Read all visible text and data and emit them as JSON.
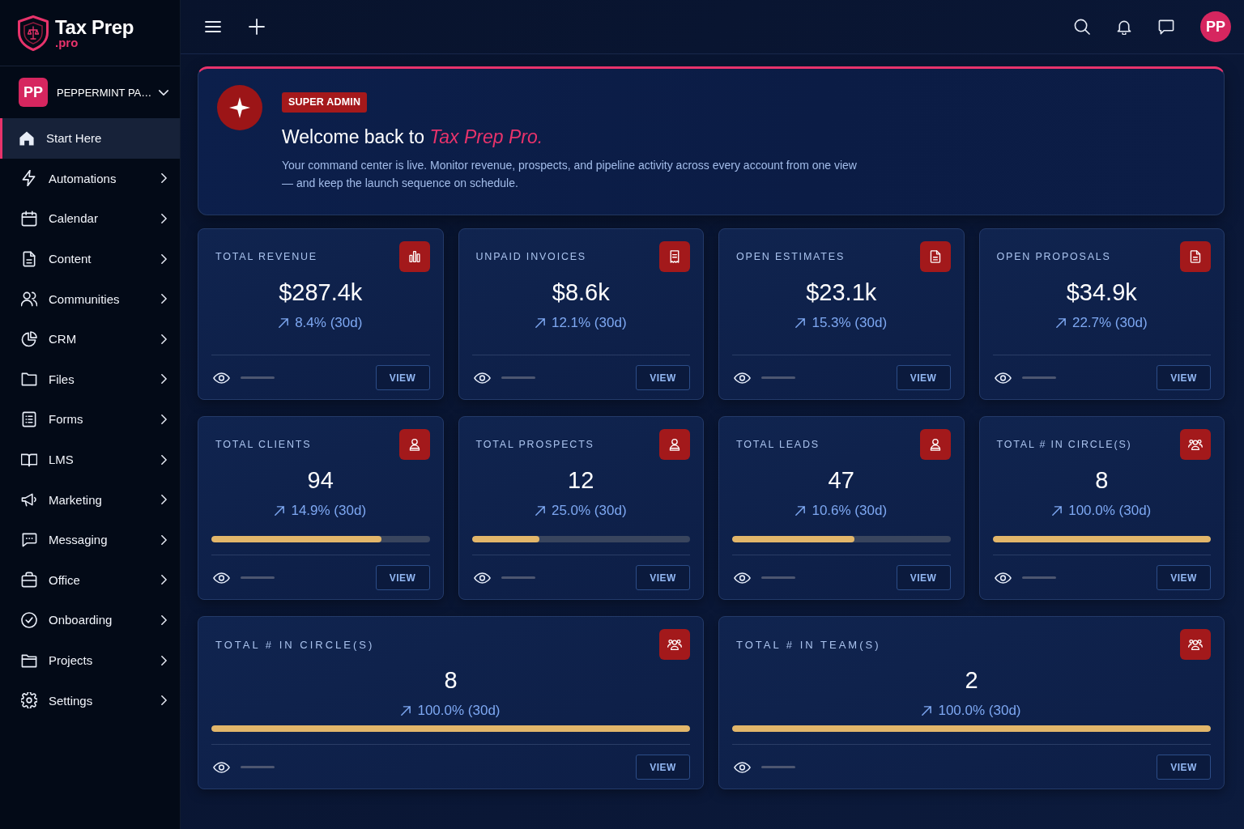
{
  "sidebar": {
    "logo": {
      "name": "Tax Prep",
      "suffix": ".pro"
    },
    "account": {
      "initials": "PP",
      "name": "PEPPERMINT PA…"
    },
    "items": [
      {
        "label": "Start Here",
        "selected": true,
        "expandable": false
      },
      {
        "label": "Automations",
        "selected": false,
        "expandable": true
      },
      {
        "label": "Calendar",
        "selected": false,
        "expandable": true
      },
      {
        "label": "Content",
        "selected": false,
        "expandable": true
      },
      {
        "label": "Communities",
        "selected": false,
        "expandable": true
      },
      {
        "label": "CRM",
        "selected": false,
        "expandable": true
      },
      {
        "label": "Files",
        "selected": false,
        "expandable": true
      },
      {
        "label": "Forms",
        "selected": false,
        "expandable": true
      },
      {
        "label": "LMS",
        "selected": false,
        "expandable": true
      },
      {
        "label": "Marketing",
        "selected": false,
        "expandable": true
      },
      {
        "label": "Messaging",
        "selected": false,
        "expandable": true
      },
      {
        "label": "Office",
        "selected": false,
        "expandable": true
      },
      {
        "label": "Onboarding",
        "selected": false,
        "expandable": true
      },
      {
        "label": "Projects",
        "selected": false,
        "expandable": true
      },
      {
        "label": "Settings",
        "selected": false,
        "expandable": true
      }
    ]
  },
  "topbar": {
    "avatar": "PP"
  },
  "banner": {
    "badge": "SUPER ADMIN",
    "title": "Welcome back to *Tax Prep Pro.*",
    "text": "Your command center is live. Monitor revenue, prospects, and pipeline activity across every account from one view — and keep the launch sequence on schedule."
  },
  "cards": [
    {
      "label": "TOTAL REVENUE",
      "value": "$287.4k",
      "trend": "8.4% (30d)",
      "action": "VIEW"
    },
    {
      "label": "UNPAID INVOICES",
      "value": "$8.6k",
      "trend": "12.1% (30d)",
      "action": "VIEW"
    },
    {
      "label": "OPEN ESTIMATES",
      "value": "$23.1k",
      "trend": "15.3% (30d)",
      "action": "VIEW"
    },
    {
      "label": "OPEN PROPOSALS",
      "value": "$34.9k",
      "trend": "22.7% (30d)",
      "action": "VIEW"
    },
    {
      "label": "TOTAL CLIENTS",
      "value": "94",
      "trend": "14.9% (30d)",
      "level": 0.78,
      "action": "VIEW"
    },
    {
      "label": "TOTAL PROSPECTS",
      "value": "12",
      "trend": "25.0% (30d)",
      "level": 0.31,
      "action": "VIEW"
    },
    {
      "label": "TOTAL LEADS",
      "value": "47",
      "trend": "10.6% (30d)",
      "level": 0.56,
      "action": "VIEW"
    },
    {
      "label": "TOTAL # IN CIRCLE(S)",
      "value": "8",
      "trend": "100.0% (30d)",
      "level": 1,
      "action": "VIEW"
    },
    {
      "label": "TOTAL # IN CIRCLE(S)",
      "value": "8",
      "trend": "100.0% (30d)",
      "level": 1,
      "action": "VIEW"
    },
    {
      "label": "TOTAL # IN TEAM(S)",
      "value": "2",
      "trend": "100.0% (30d)",
      "level": 1,
      "action": "VIEW"
    }
  ]
}
